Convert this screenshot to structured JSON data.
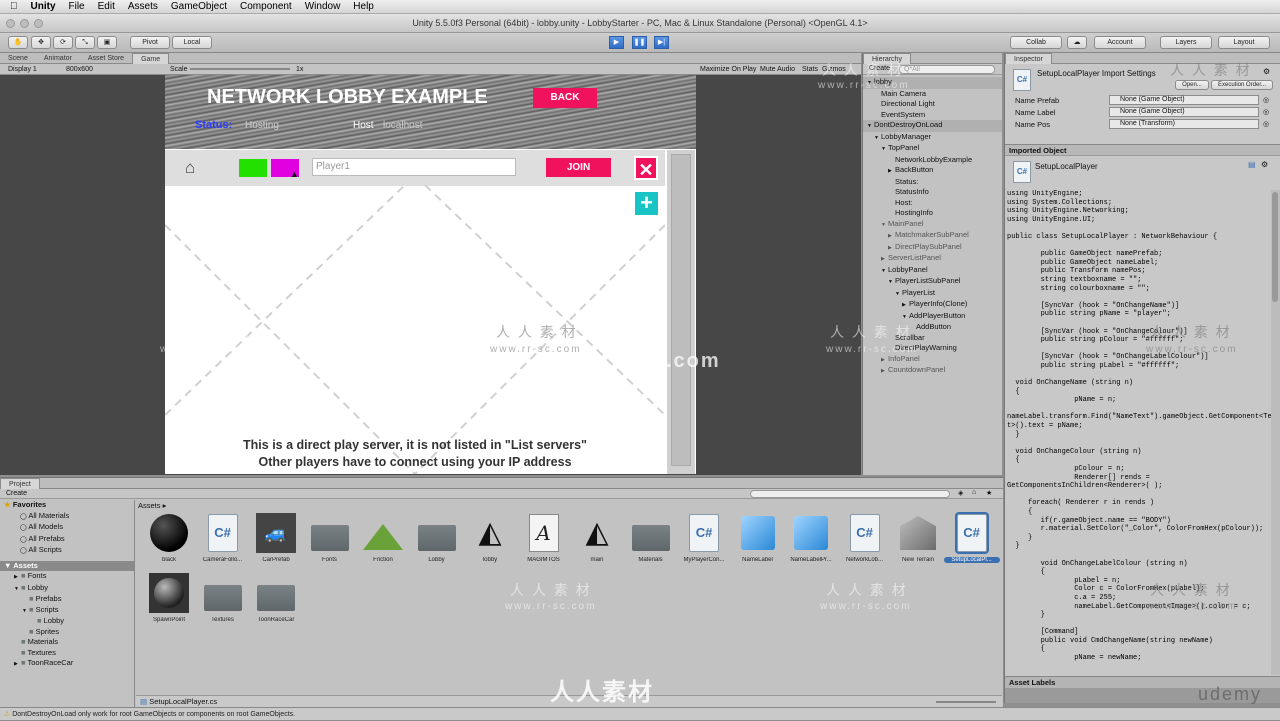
{
  "mac_menu": [
    "Unity",
    "File",
    "Edit",
    "Assets",
    "GameObject",
    "Component",
    "Window",
    "Help"
  ],
  "window_title": "Unity 5.5.0f3 Personal (64bit) - lobby.unity - LobbyStarter - PC, Mac & Linux Standalone (Personal) <OpenGL 4.1>",
  "toolbar": {
    "pivot": "Pivot",
    "local": "Local",
    "collab": "Collab",
    "account": "Account",
    "layers": "Layers",
    "layout": "Layout"
  },
  "scene_tabs": [
    "Scene",
    "Animator",
    "Asset Store",
    "Game"
  ],
  "game_options": {
    "display": "Display 1",
    "resolution": "800x600",
    "scale_label": "Scale",
    "scale_value": "1x",
    "maximize": "Maximize On Play",
    "mute": "Mute Audio",
    "stats": "Stats",
    "gizmos": "Gizmos"
  },
  "game": {
    "title": "NETWORK LOBBY EXAMPLE",
    "back": "BACK",
    "status_left": "Status:",
    "status_left_value": "Hosting",
    "host_label": "Host",
    "host_value": "localhost",
    "player_name": "Player1",
    "join": "JOIN",
    "close": "✕",
    "add": "+",
    "color_1": "#22e000",
    "color_2": "#e000e0",
    "footer_1": "This is a direct play server, it is not listed in \"List servers\"",
    "footer_2": "Other players have to connect using your IP address"
  },
  "hierarchy": {
    "tab": "Hierarchy",
    "create": "Create",
    "search": "Q*All",
    "items": [
      "lobby",
      "Main Camera",
      "Directional Light",
      "EventSystem",
      "DontDestroyOnLoad",
      "LobbyManager",
      "TopPanel",
      "NetworkLobbyExample",
      "BackButton",
      "Status:",
      "StatusInfo",
      "Host:",
      "HostingInfo",
      "MainPanel",
      "MatchmakerSubPanel",
      "DirectPlaySubPanel",
      "ServerListPanel",
      "LobbyPanel",
      "PlayerListSubPanel",
      "PlayerList",
      "PlayerInfo(Clone)",
      "AddPlayerButton",
      "AddButton",
      "Scrollbar",
      "DirectPlayWarning",
      "InfoPanel",
      "CountdownPanel"
    ]
  },
  "inspector": {
    "tab": "Inspector",
    "header": "SetupLocalPlayer Import Settings",
    "open": "Open...",
    "exec_order": "Execution Order...",
    "fields": [
      {
        "label": "Name Prefab",
        "value": "None (Game Object)"
      },
      {
        "label": "Name Label",
        "value": "None (Game Object)"
      },
      {
        "label": "Name Pos",
        "value": "None (Transform)"
      }
    ],
    "imported_object": "Imported Object",
    "imported_name": "SetupLocalPlayer",
    "asset_labels": "Asset Labels",
    "code": "using UnityEngine;\nusing System.Collections;\nusing UnityEngine.Networking;\nusing UnityEngine.UI;\n\npublic class SetupLocalPlayer : NetworkBehaviour {\n\n        public GameObject namePrefab;\n        public GameObject nameLabel;\n        public Transform namePos;\n        string textboxname = \"\";\n        string colourboxname = \"\";\n\n        [SyncVar (hook = \"OnChangeName\")]\n        public string pName = \"player\";\n\n        [SyncVar (hook = \"OnChangeColour\")]\n        public string pColour = \"#ffffff\";\n\n        [SyncVar (hook = \"OnChangeLabelColour\")]\n        public string pLabel = \"#ffffff\";\n\n  void OnChangeName (string n)\n  {\n                pName = n;\n\nnameLabel.transform.Find(\"NameText\").gameObject.GetComponent<Tex\nt>().text = pName;\n  }\n\n  void OnChangeColour (string n)\n  {\n                pColour = n;\n                Renderer[] rends =\nGetComponentsInChildren<Renderer>( );\n\n     foreach( Renderer r in rends )\n     {\n        if(r.gameObject.name == \"BODY\")\n        r.material.SetColor(\"_Color\", ColorFromHex(pColour));\n     }\n  }\n\n        void OnChangeLabelColour (string n)\n        {\n                pLabel = n;\n                Color c = ColorFromHex(pLabel);\n                c.a = 255;\n                nameLabel.GetComponent<Image>().color = c;\n        }\n\n        [Command]\n        public void CmdChangeName(string newName)\n        {\n                pName = newName;"
  },
  "project": {
    "tab": "Project",
    "create": "Create",
    "favorites": "Favorites",
    "fav_items": [
      "All Materials",
      "All Models",
      "All Prefabs",
      "All Scripts"
    ],
    "assets_root": "Assets",
    "tree": [
      "Fonts",
      "Lobby",
      "Prefabs",
      "Scripts",
      "Lobby",
      "Sprites",
      "Materials",
      "Textures",
      "ToonRaceCar"
    ],
    "breadcrumb": "Assets",
    "assets": [
      {
        "name": "black",
        "type": "sphere"
      },
      {
        "name": "CameraFollo...",
        "type": "cs"
      },
      {
        "name": "CarPrefab",
        "type": "car"
      },
      {
        "name": "Fonts",
        "type": "folder"
      },
      {
        "name": "Friction",
        "type": "friction"
      },
      {
        "name": "Lobby",
        "type": "folder"
      },
      {
        "name": "lobby",
        "type": "unity"
      },
      {
        "name": "MAGIMTOS",
        "type": "font"
      },
      {
        "name": "main",
        "type": "unity"
      },
      {
        "name": "Materials",
        "type": "folder"
      },
      {
        "name": "MyPlayerCon...",
        "type": "cs"
      },
      {
        "name": "NameLabel",
        "type": "cube"
      },
      {
        "name": "NameLabelPr...",
        "type": "cube"
      },
      {
        "name": "NetworkLob...",
        "type": "cs"
      },
      {
        "name": "New Terrain",
        "type": "terrain"
      },
      {
        "name": "SetupLocalPl...",
        "type": "cs-selected"
      },
      {
        "name": "SpawnPoint",
        "type": "sphere2"
      },
      {
        "name": "Textures",
        "type": "folder"
      },
      {
        "name": "ToonRaceCar",
        "type": "folder"
      }
    ],
    "selected_file": "SetupLocalPlayer.cs"
  },
  "status_message": "DontDestroyOnLoad only work for root GameObjects or components on root GameObjects.",
  "watermarks": [
    "人 人 素 材",
    "www.rr-sc.com",
    "人人素材",
    "udemy"
  ]
}
